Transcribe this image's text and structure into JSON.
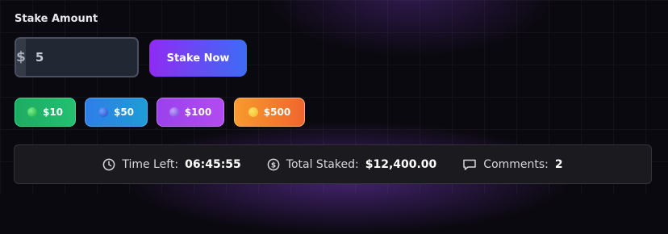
{
  "stake": {
    "label": "Stake Amount",
    "currency_symbol": "$",
    "value": "5",
    "button_label": "Stake Now"
  },
  "chips": [
    {
      "label": "$10",
      "color": "#1eab62"
    },
    {
      "label": "$50",
      "color": "#2e7ee8"
    },
    {
      "label": "$100",
      "color": "#9a42ec"
    },
    {
      "label": "$500",
      "color": "#f0652e"
    }
  ],
  "info": {
    "time_left_label": "Time Left:",
    "time_left_value": "06:45:55",
    "total_staked_label": "Total Staked:",
    "total_staked_value": "$12,400.00",
    "comments_label": "Comments:",
    "comments_value": "2"
  },
  "colors": {
    "background": "#0b0910",
    "accent_start": "#8f2bf2",
    "accent_end": "#3d6cf6"
  }
}
